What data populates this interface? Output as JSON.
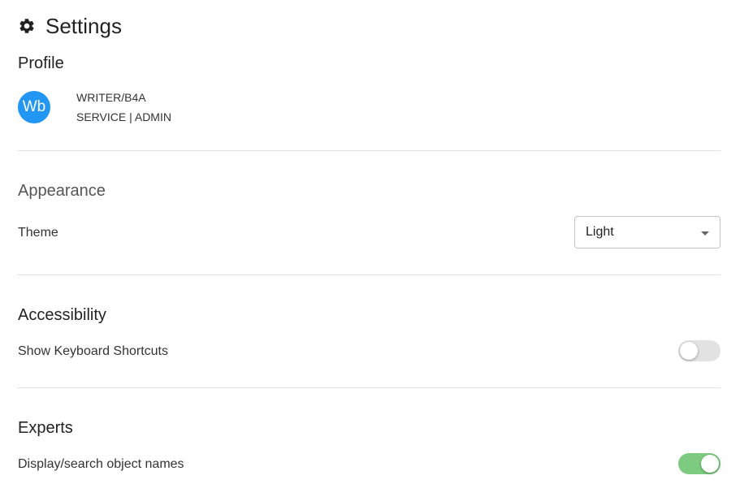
{
  "header": {
    "title": "Settings",
    "icon": "gear-icon"
  },
  "profile": {
    "section_title": "Profile",
    "avatar_initials": "Wb",
    "avatar_color": "#2196f3",
    "name": "WRITER/B4A",
    "role": "SERVICE | ADMIN"
  },
  "appearance": {
    "section_title": "Appearance",
    "theme_label": "Theme",
    "theme_value": "Light"
  },
  "accessibility": {
    "section_title": "Accessibility",
    "shortcuts_label": "Show Keyboard Shortcuts",
    "shortcuts_enabled": false
  },
  "experts": {
    "section_title": "Experts",
    "object_names_label": "Display/search object names",
    "object_names_enabled": true,
    "toggle_on_color": "#7ccb80"
  }
}
